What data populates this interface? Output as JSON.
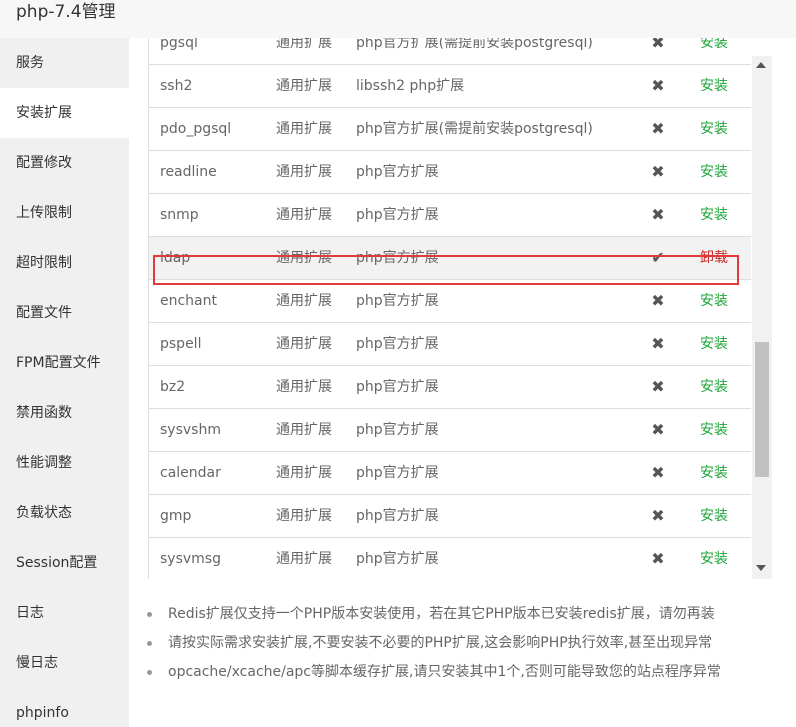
{
  "window": {
    "title": "php-7.4管理"
  },
  "sidebar": {
    "items": [
      {
        "label": "服务",
        "active": false
      },
      {
        "label": "安装扩展",
        "active": true
      },
      {
        "label": "配置修改",
        "active": false
      },
      {
        "label": "上传限制",
        "active": false
      },
      {
        "label": "超时限制",
        "active": false
      },
      {
        "label": "配置文件",
        "active": false
      },
      {
        "label": "FPM配置文件",
        "active": false
      },
      {
        "label": "禁用函数",
        "active": false
      },
      {
        "label": "性能调整",
        "active": false
      },
      {
        "label": "负载状态",
        "active": false
      },
      {
        "label": "Session配置",
        "active": false
      },
      {
        "label": "日志",
        "active": false
      },
      {
        "label": "慢日志",
        "active": false
      },
      {
        "label": "phpinfo",
        "active": false
      }
    ]
  },
  "extensions": {
    "rows": [
      {
        "name": "pgsql",
        "type": "通用扩展",
        "desc": "php官方扩展(需提前安装postgresql)",
        "installed": false,
        "action": "安装"
      },
      {
        "name": "ssh2",
        "type": "通用扩展",
        "desc": "libssh2 php扩展",
        "installed": false,
        "action": "安装"
      },
      {
        "name": "pdo_pgsql",
        "type": "通用扩展",
        "desc": "php官方扩展(需提前安装postgresql)",
        "installed": false,
        "action": "安装"
      },
      {
        "name": "readline",
        "type": "通用扩展",
        "desc": "php官方扩展",
        "installed": false,
        "action": "安装"
      },
      {
        "name": "snmp",
        "type": "通用扩展",
        "desc": "php官方扩展",
        "installed": false,
        "action": "安装"
      },
      {
        "name": "ldap",
        "type": "通用扩展",
        "desc": "php官方扩展",
        "installed": true,
        "action": "卸载"
      },
      {
        "name": "enchant",
        "type": "通用扩展",
        "desc": "php官方扩展",
        "installed": false,
        "action": "安装"
      },
      {
        "name": "pspell",
        "type": "通用扩展",
        "desc": "php官方扩展",
        "installed": false,
        "action": "安装"
      },
      {
        "name": "bz2",
        "type": "通用扩展",
        "desc": "php官方扩展",
        "installed": false,
        "action": "安装"
      },
      {
        "name": "sysvshm",
        "type": "通用扩展",
        "desc": "php官方扩展",
        "installed": false,
        "action": "安装"
      },
      {
        "name": "calendar",
        "type": "通用扩展",
        "desc": "php官方扩展",
        "installed": false,
        "action": "安装"
      },
      {
        "name": "gmp",
        "type": "通用扩展",
        "desc": "php官方扩展",
        "installed": false,
        "action": "安装"
      },
      {
        "name": "sysvmsg",
        "type": "通用扩展",
        "desc": "php官方扩展",
        "installed": false,
        "action": "安装"
      }
    ]
  },
  "icons": {
    "not_installed": "x-icon",
    "installed": "check-icon"
  },
  "colors": {
    "install": "#20a53a",
    "uninstall": "#cc2d2d",
    "highlight_border": "#e03a3a"
  },
  "tips": [
    "Redis扩展仅支持一个PHP版本安装使用，若在其它PHP版本已安装redis扩展，请勿再装",
    "请按实际需求安装扩展,不要安装不必要的PHP扩展,这会影响PHP执行效率,甚至出现异常",
    "opcache/xcache/apc等脚本缓存扩展,请只安装其中1个,否则可能导致您的站点程序异常"
  ]
}
